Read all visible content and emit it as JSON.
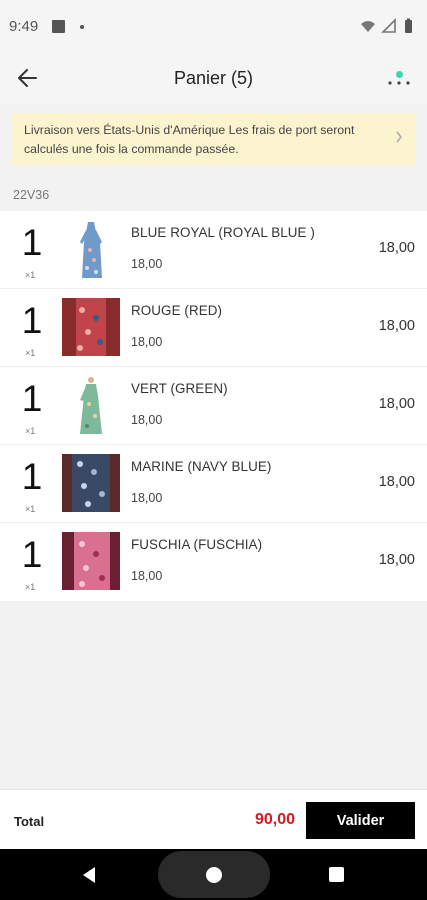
{
  "status": {
    "time": "9:49"
  },
  "header": {
    "title": "Panier (5)",
    "back_icon": "arrow-left-icon",
    "more_icon": "more-horizontal-icon",
    "notification_color": "#3dd6b0"
  },
  "banner": {
    "text": "Livraison vers  États-Unis d'Amérique Les frais de port seront calculés une fois la commande passée.",
    "background": "#fcf3cf"
  },
  "group": {
    "label": "22V36"
  },
  "items": [
    {
      "qty": "1",
      "qty_sub": "×1",
      "name": "BLUE ROYAL (ROYAL BLUE )",
      "price": "18,00",
      "total": "18,00"
    },
    {
      "qty": "1",
      "qty_sub": "×1",
      "name": "ROUGE (RED)",
      "price": "18,00",
      "total": "18,00"
    },
    {
      "qty": "1",
      "qty_sub": "×1",
      "name": "VERT (GREEN)",
      "price": "18,00",
      "total": "18,00"
    },
    {
      "qty": "1",
      "qty_sub": "×1",
      "name": "MARINE (NAVY BLUE)",
      "price": "18,00",
      "total": "18,00"
    },
    {
      "qty": "1",
      "qty_sub": "×1",
      "name": "FUSCHIA (FUSCHIA)",
      "price": "18,00",
      "total": "18,00"
    }
  ],
  "footer": {
    "total_label": "Total",
    "total_amount": "90,00",
    "total_color": "#d71920",
    "button_label": "Valider"
  }
}
